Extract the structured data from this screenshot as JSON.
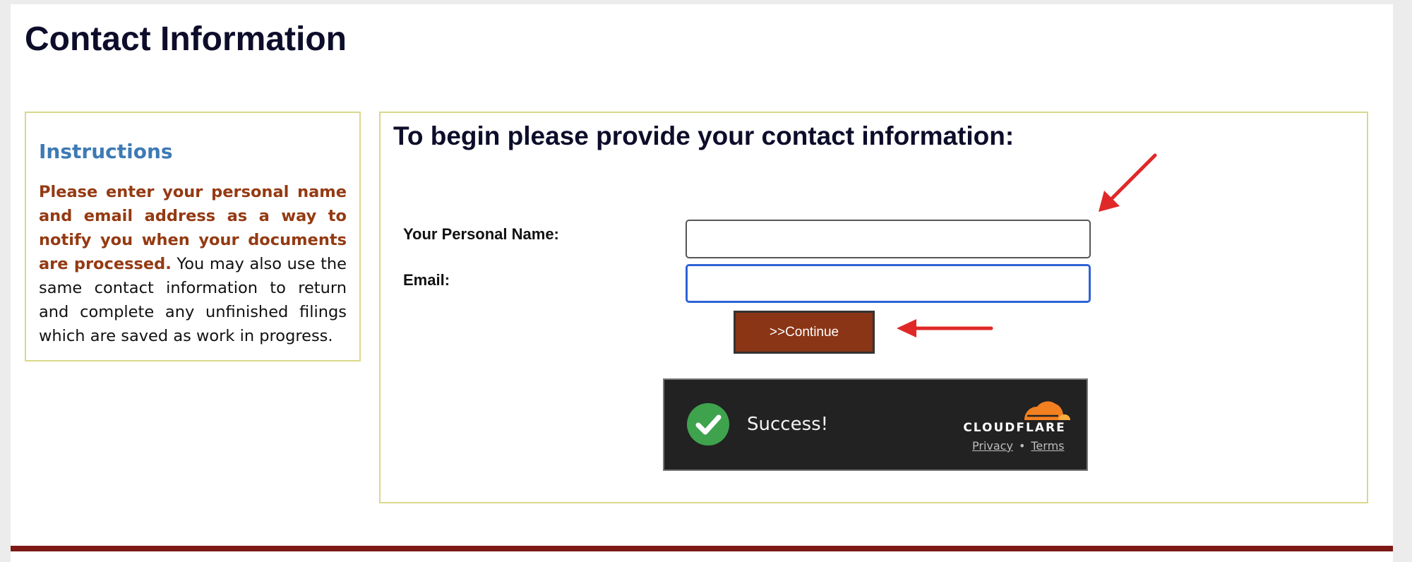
{
  "page": {
    "title": "Contact Information"
  },
  "instructions": {
    "title": "Instructions",
    "emphasis": "Please enter your personal name and email address as a way to notify you when your documents are processed.",
    "body": " You may also use the same contact information to return and complete any unfinished filings which are saved as work in progress."
  },
  "form": {
    "heading": "To begin please provide your contact information:",
    "name_label": "Your Personal Name:",
    "name_value": "",
    "email_label": "Email:",
    "email_value": "",
    "continue_label": ">>Continue"
  },
  "captcha": {
    "status": "Success!",
    "brand": "CLOUDFLARE",
    "privacy_label": "Privacy",
    "separator": "•",
    "terms_label": "Terms",
    "brand_color": "#f38020",
    "success_color": "#3fa34d",
    "icons": [
      "check-circle-icon",
      "cloudflare-cloud-icon"
    ]
  },
  "annotations": {
    "arrow_color": "#e02828",
    "arrows": [
      "arrow-to-name-field",
      "arrow-to-continue-button"
    ]
  },
  "colors": {
    "footer": "#7d1a16",
    "panel_border": "#d9d98a",
    "button": "#8a3515",
    "instruction_title": "#3d7ab5",
    "instruction_emphasis": "#943a12"
  }
}
